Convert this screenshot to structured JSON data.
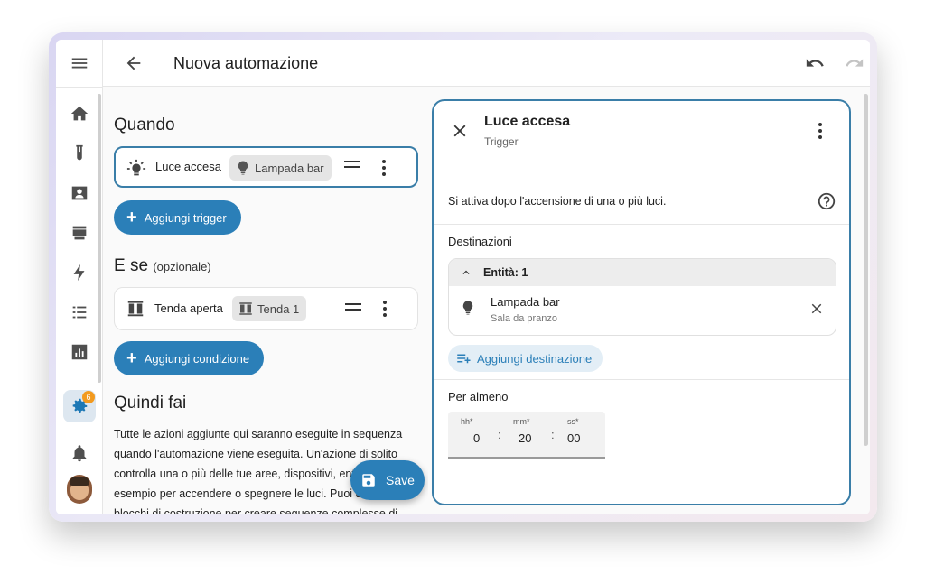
{
  "app": {
    "title": "Nuova automazione"
  },
  "sidebar": {
    "items": [
      {
        "icon": "home-icon"
      },
      {
        "icon": "test-tube-icon"
      },
      {
        "icon": "person-card-icon"
      },
      {
        "icon": "hacs-store-icon"
      },
      {
        "icon": "lightning-icon"
      },
      {
        "icon": "list-icon"
      },
      {
        "icon": "chart-icon"
      },
      {
        "icon": "gear-icon",
        "badge": "6",
        "active": true
      },
      {
        "icon": "bell-icon"
      }
    ]
  },
  "editor": {
    "when_title": "Quando",
    "trigger": {
      "label": "Luce accesa",
      "chip": "Lampada bar"
    },
    "add_trigger": "Aggiungi trigger",
    "and_if_title": "E se",
    "and_if_optional": "(opzionale)",
    "condition": {
      "label": "Tenda aperta",
      "chip": "Tenda 1"
    },
    "add_condition": "Aggiungi condizione",
    "then_title": "Quindi fai",
    "then_text": "Tutte le azioni aggiunte qui saranno eseguite in sequenza quando l'automazione viene eseguita. Un'azione di solito controlla una o più delle tue aree, dispositivi, entità. Ad esempio per accendere o spegnere le luci. Puoi usare i blocchi di costruzione per creare sequenze complesse di",
    "save": "Save"
  },
  "panel": {
    "title": "Luce accesa",
    "subtitle": "Trigger",
    "description": "Si attiva dopo l'accensione di una o più luci.",
    "targets_label": "Destinazioni",
    "entities_header": "Entità: 1",
    "entity": {
      "name": "Lampada bar",
      "area": "Sala da pranzo"
    },
    "add_target": "Aggiungi destinazione",
    "duration_label": "Per almeno",
    "duration": {
      "hh_label": "hh*",
      "hh": "0",
      "mm_label": "mm*",
      "mm": "20",
      "ss_label": "ss*",
      "ss": "00",
      "sep": ":"
    }
  },
  "colors": {
    "accent": "#2b7fb8",
    "selected_border": "#3a7ea8",
    "badge": "#f29a1f"
  }
}
